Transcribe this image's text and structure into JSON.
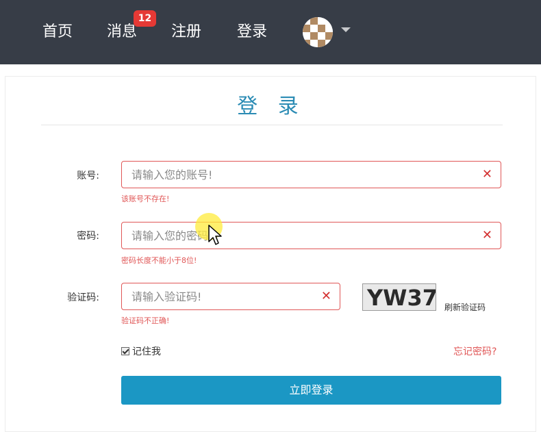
{
  "navbar": {
    "items": [
      {
        "label": "首页"
      },
      {
        "label": "消息"
      },
      {
        "label": "注册"
      },
      {
        "label": "登录"
      }
    ],
    "message_badge": "12",
    "avatar_icon": "avatar-icon",
    "caret_icon": "caret-down-icon"
  },
  "login": {
    "title": "登 录",
    "account": {
      "label": "账号:",
      "placeholder": "请输入您的账号!",
      "value": "",
      "error": "该账号不存在!"
    },
    "password": {
      "label": "密码:",
      "placeholder": "请输入您的密码!",
      "value": "",
      "error": "密码长度不能小于8位!"
    },
    "captcha": {
      "label": "验证码:",
      "placeholder": "请输入验证码!",
      "value": "",
      "error": "验证码不正确!",
      "image_text": "YW37",
      "refresh_label": "刷新验证码"
    },
    "remember_label": "记住我",
    "forgot_label": "忘记密码?",
    "submit_label": "立即登录"
  },
  "colors": {
    "navbar_bg": "#373d47",
    "accent": "#1b97c4",
    "title": "#2a8bb4",
    "error": "#e05656",
    "badge": "#e53935"
  }
}
